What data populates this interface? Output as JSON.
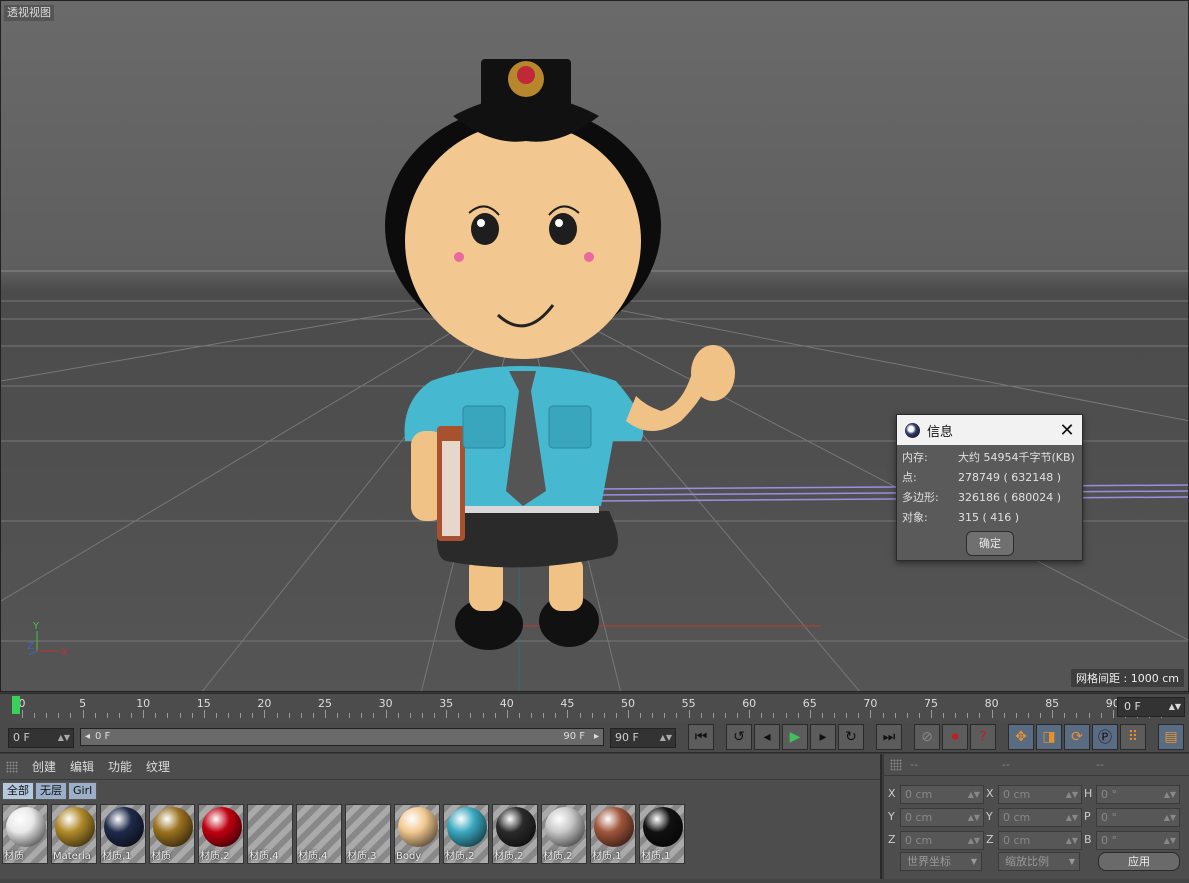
{
  "viewport": {
    "title": "透视视图",
    "grid_spacing": "网格间距 : 1000 cm",
    "axis_labels": {
      "x": "X",
      "y": "Y",
      "z": "Z"
    }
  },
  "info_dialog": {
    "title": "信息",
    "rows": [
      {
        "key": "内存:",
        "value": "大约 54954千字节(KB)"
      },
      {
        "key": "点:",
        "value": "278749 ( 632148 )"
      },
      {
        "key": "多边形:",
        "value": "326186 ( 680024 )"
      },
      {
        "key": "对象:",
        "value": "315 ( 416 )"
      }
    ],
    "ok_label": "确定"
  },
  "timeline": {
    "ticks": [
      "0",
      "5",
      "10",
      "15",
      "20",
      "25",
      "30",
      "35",
      "40",
      "45",
      "50",
      "55",
      "60",
      "65",
      "70",
      "75",
      "80",
      "85",
      "90"
    ],
    "current_frame": "0 F",
    "end_frame": "0 F"
  },
  "transport": {
    "start_field": "0 F",
    "range_start": "0 F",
    "range_end": "90 F",
    "end_field": "90 F"
  },
  "materials": {
    "menu": [
      "创建",
      "编辑",
      "功能",
      "纹理"
    ],
    "tabs": [
      "全部",
      "无层",
      "Girl"
    ],
    "items": [
      {
        "label": "材质",
        "color": "#e8e8e8"
      },
      {
        "label": "Materia",
        "color": "#b08a2a"
      },
      {
        "label": "材质.1",
        "color": "#1f2a4a"
      },
      {
        "label": "材质",
        "color": "#9a7220"
      },
      {
        "label": "材质.2",
        "color": "#c00010"
      },
      {
        "label": "材质.4",
        "color": ""
      },
      {
        "label": "材质.4",
        "color": ""
      },
      {
        "label": "材质.3",
        "color": ""
      },
      {
        "label": "Body",
        "color": "#f2c890"
      },
      {
        "label": "材质.2",
        "color": "#3aa8c0"
      },
      {
        "label": "材质.2",
        "color": "#2a2a2a"
      },
      {
        "label": "材质.2",
        "color": "#c8c8c8"
      },
      {
        "label": "材质.1",
        "color": "#a0553a"
      },
      {
        "label": "材质.1",
        "color": "#111111"
      }
    ]
  },
  "coordinates": {
    "headers": [
      "--",
      "--",
      "--"
    ],
    "rows": [
      {
        "a": "X",
        "av": "0 cm",
        "b": "X",
        "bv": "0 cm",
        "c": "H",
        "cv": "0 °"
      },
      {
        "a": "Y",
        "av": "0 cm",
        "b": "Y",
        "bv": "0 cm",
        "c": "P",
        "cv": "0 °"
      },
      {
        "a": "Z",
        "av": "0 cm",
        "b": "Z",
        "bv": "0 cm",
        "c": "B",
        "cv": "0 °"
      }
    ],
    "world_label": "世界坐标",
    "scale_label": "缩放比例",
    "apply_label": "应用"
  }
}
